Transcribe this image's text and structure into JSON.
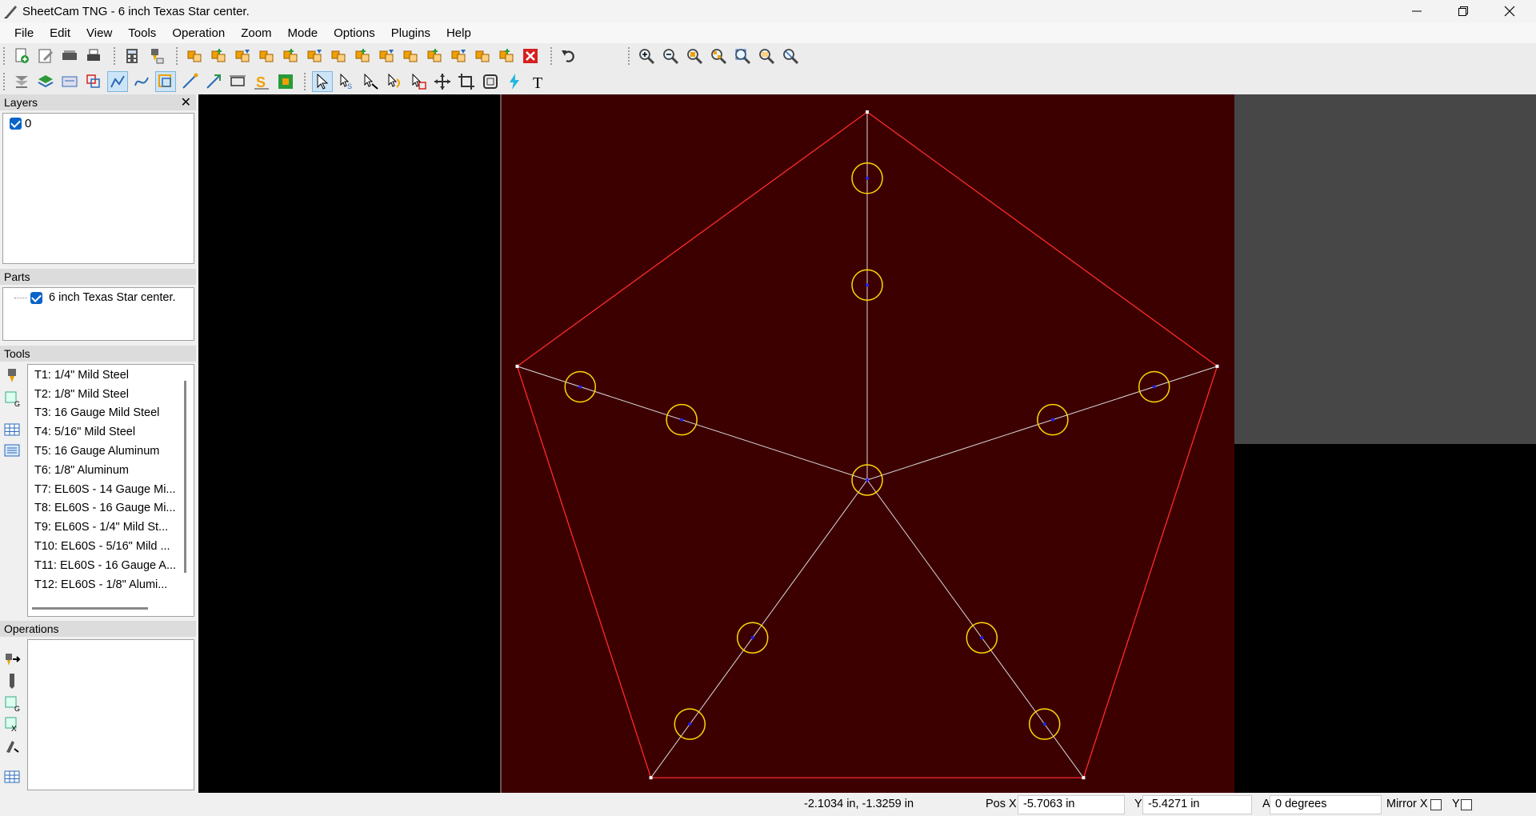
{
  "window": {
    "title": "SheetCam TNG - 6 inch Texas Star center."
  },
  "menu": {
    "items": [
      "File",
      "Edit",
      "View",
      "Tools",
      "Operation",
      "Zoom",
      "Mode",
      "Options",
      "Plugins",
      "Help"
    ]
  },
  "layers": {
    "header": "Layers",
    "items": [
      {
        "label": "0",
        "checked": true
      }
    ]
  },
  "parts": {
    "header": "Parts",
    "items": [
      {
        "label": "6 inch Texas Star center.",
        "checked": true
      }
    ]
  },
  "tools": {
    "header": "Tools",
    "items": [
      "T1: 1/4\" Mild Steel",
      "T2: 1/8\" Mild Steel",
      "T3: 16 Gauge Mild Steel",
      "T4: 5/16\" Mild Steel",
      "T5: 16 Gauge Aluminum",
      "T6: 1/8\" Aluminum",
      "T7: EL60S - 14 Gauge Mi...",
      "T8: EL60S - 16 Gauge Mi...",
      "T9: EL60S - 1/4\" Mild St...",
      "T10: EL60S - 5/16\" Mild ...",
      "T11: EL60S - 16 Gauge A...",
      "T12: EL60S - 1/8\" Alumi..."
    ]
  },
  "operations": {
    "header": "Operations"
  },
  "status": {
    "cursor": "-2.1034 in, -1.3259 in",
    "pos_x_label": "Pos X",
    "pos_x_value": "-5.7063 in",
    "y_label": "Y",
    "y_value": "-5.4271 in",
    "a_label": "A",
    "a_value": "0 degrees",
    "mirror_x_label": "Mirror X",
    "mirror_y_label": "Y"
  },
  "colors": {
    "canvas_bg": "#000000",
    "work_area": "#3d0000",
    "outline": "#ff2a2a",
    "spokes": "#d8d8d8",
    "holes": "#ffd700",
    "hole_center": "#1e22ff"
  }
}
